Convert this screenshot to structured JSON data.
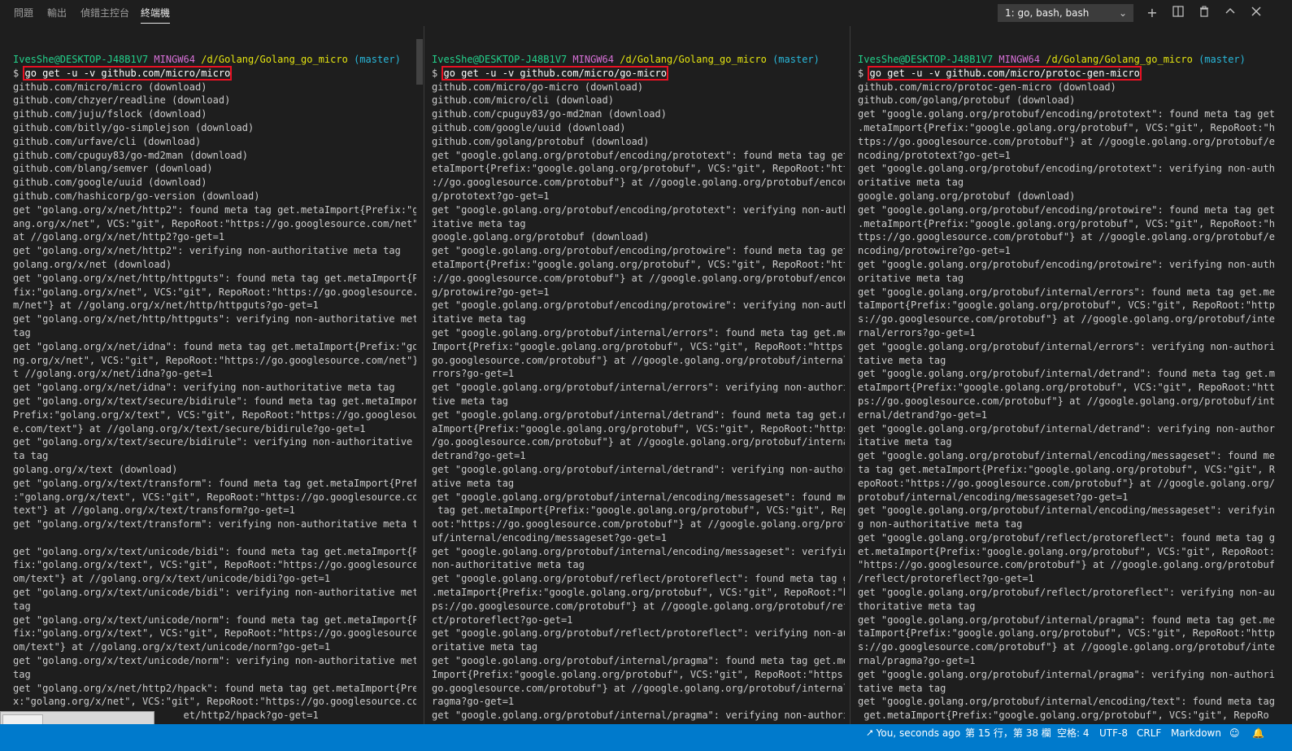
{
  "panel_tabs": [
    "問題",
    "輸出",
    "偵錯主控台",
    "終端機"
  ],
  "terminal_selector": "1: go, bash, bash",
  "toolbar_icons": [
    "plus-icon",
    "split-icon",
    "trash-icon",
    "chevron-up-icon",
    "close-icon"
  ],
  "prompt": {
    "user": "IvesShe@DESKTOP-J48B1V7",
    "system": "MINGW64",
    "path": "/d/Golang/Golang_go_micro",
    "branch": "(master)",
    "symbol": "$"
  },
  "panes": [
    {
      "command": "go get -u -v github.com/micro/micro",
      "output": "github.com/micro/micro (download)\ngithub.com/chzyer/readline (download)\ngithub.com/juju/fslock (download)\ngithub.com/bitly/go-simplejson (download)\ngithub.com/urfave/cli (download)\ngithub.com/cpuguy83/go-md2man (download)\ngithub.com/blang/semver (download)\ngithub.com/google/uuid (download)\ngithub.com/hashicorp/go-version (download)\nget \"golang.org/x/net/http2\": found meta tag get.metaImport{Prefix:\"gol\nang.org/x/net\", VCS:\"git\", RepoRoot:\"https://go.googlesource.com/net\"}\nat //golang.org/x/net/http2?go-get=1\nget \"golang.org/x/net/http2\": verifying non-authoritative meta tag\ngolang.org/x/net (download)\nget \"golang.org/x/net/http/httpguts\": found meta tag get.metaImport{Pre\nfix:\"golang.org/x/net\", VCS:\"git\", RepoRoot:\"https://go.googlesource.co\nm/net\"} at //golang.org/x/net/http/httpguts?go-get=1\nget \"golang.org/x/net/http/httpguts\": verifying non-authoritative meta\ntag\nget \"golang.org/x/net/idna\": found meta tag get.metaImport{Prefix:\"gola\nng.org/x/net\", VCS:\"git\", RepoRoot:\"https://go.googlesource.com/net\"} a\nt //golang.org/x/net/idna?go-get=1\nget \"golang.org/x/net/idna\": verifying non-authoritative meta tag\nget \"golang.org/x/text/secure/bidirule\": found meta tag get.metaImport{\nPrefix:\"golang.org/x/text\", VCS:\"git\", RepoRoot:\"https://go.googlesourc\ne.com/text\"} at //golang.org/x/text/secure/bidirule?go-get=1\nget \"golang.org/x/text/secure/bidirule\": verifying non-authoritative me\nta tag\ngolang.org/x/text (download)\nget \"golang.org/x/text/transform\": found meta tag get.metaImport{Prefix\n:\"golang.org/x/text\", VCS:\"git\", RepoRoot:\"https://go.googlesource.com/\ntext\"} at //golang.org/x/text/transform?go-get=1\nget \"golang.org/x/text/transform\": verifying non-authoritative meta tag\n\nget \"golang.org/x/text/unicode/bidi\": found meta tag get.metaImport{Pre\nfix:\"golang.org/x/text\", VCS:\"git\", RepoRoot:\"https://go.googlesource.c\nom/text\"} at //golang.org/x/text/unicode/bidi?go-get=1\nget \"golang.org/x/text/unicode/bidi\": verifying non-authoritative meta\ntag\nget \"golang.org/x/text/unicode/norm\": found meta tag get.metaImport{Pre\nfix:\"golang.org/x/text\", VCS:\"git\", RepoRoot:\"https://go.googlesource.c\nom/text\"} at //golang.org/x/text/unicode/norm?go-get=1\nget \"golang.org/x/text/unicode/norm\": verifying non-authoritative meta\ntag\nget \"golang.org/x/net/http2/hpack\": found meta tag get.metaImport{Prefi\nx:\"golang.org/x/net\", VCS:\"git\", RepoRoot:\"https://go.googlesource.com/\n                             et/http2/hpack?go-get=1"
    },
    {
      "command": "go get -u -v github.com/micro/go-micro",
      "output": "github.com/micro/go-micro (download)\ngithub.com/micro/cli (download)\ngithub.com/cpuguy83/go-md2man (download)\ngithub.com/google/uuid (download)\ngithub.com/golang/protobuf (download)\nget \"google.golang.org/protobuf/encoding/prototext\": found meta tag get.m\netaImport{Prefix:\"google.golang.org/protobuf\", VCS:\"git\", RepoRoot:\"https\n://go.googlesource.com/protobuf\"} at //google.golang.org/protobuf/encodin\ng/prototext?go-get=1\nget \"google.golang.org/protobuf/encoding/prototext\": verifying non-author\nitative meta tag\ngoogle.golang.org/protobuf (download)\nget \"google.golang.org/protobuf/encoding/protowire\": found meta tag get.m\netaImport{Prefix:\"google.golang.org/protobuf\", VCS:\"git\", RepoRoot:\"https\n://go.googlesource.com/protobuf\"} at //google.golang.org/protobuf/encodin\ng/protowire?go-get=1\nget \"google.golang.org/protobuf/encoding/protowire\": verifying non-author\nitative meta tag\nget \"google.golang.org/protobuf/internal/errors\": found meta tag get.meta\nImport{Prefix:\"google.golang.org/protobuf\", VCS:\"git\", RepoRoot:\"https://\ngo.googlesource.com/protobuf\"} at //google.golang.org/protobuf/internal/e\nrrors?go-get=1\nget \"google.golang.org/protobuf/internal/errors\": verifying non-authorita\ntive meta tag\nget \"google.golang.org/protobuf/internal/detrand\": found meta tag get.met\naImport{Prefix:\"google.golang.org/protobuf\", VCS:\"git\", RepoRoot:\"https:/\n/go.googlesource.com/protobuf\"} at //google.golang.org/protobuf/internal/\ndetrand?go-get=1\nget \"google.golang.org/protobuf/internal/detrand\": verifying non-authorit\native meta tag\nget \"google.golang.org/protobuf/internal/encoding/messageset\": found meta\n tag get.metaImport{Prefix:\"google.golang.org/protobuf\", VCS:\"git\", RepoR\noot:\"https://go.googlesource.com/protobuf\"} at //google.golang.org/protob\nuf/internal/encoding/messageset?go-get=1\nget \"google.golang.org/protobuf/internal/encoding/messageset\": verifying\nnon-authoritative meta tag\nget \"google.golang.org/protobuf/reflect/protoreflect\": found meta tag get\n.metaImport{Prefix:\"google.golang.org/protobuf\", VCS:\"git\", RepoRoot:\"htt\nps://go.googlesource.com/protobuf\"} at //google.golang.org/protobuf/refle\nct/protoreflect?go-get=1\nget \"google.golang.org/protobuf/reflect/protoreflect\": verifying non-auth\noritative meta tag\nget \"google.golang.org/protobuf/internal/pragma\": found meta tag get.meta\nImport{Prefix:\"google.golang.org/protobuf\", VCS:\"git\", RepoRoot:\"https://\ngo.googlesource.com/protobuf\"} at //google.golang.org/protobuf/internal/p\nragma?go-get=1\nget \"google.golang.org/protobuf/internal/pragma\": verifying non-authorita"
    },
    {
      "command": "go get -u -v github.com/micro/protoc-gen-micro",
      "output": "github.com/micro/protoc-gen-micro (download)\ngithub.com/golang/protobuf (download)\nget \"google.golang.org/protobuf/encoding/prototext\": found meta tag get\n.metaImport{Prefix:\"google.golang.org/protobuf\", VCS:\"git\", RepoRoot:\"h\nttps://go.googlesource.com/protobuf\"} at //google.golang.org/protobuf/e\nncoding/prototext?go-get=1\nget \"google.golang.org/protobuf/encoding/prototext\": verifying non-auth\noritative meta tag\ngoogle.golang.org/protobuf (download)\nget \"google.golang.org/protobuf/encoding/protowire\": found meta tag get\n.metaImport{Prefix:\"google.golang.org/protobuf\", VCS:\"git\", RepoRoot:\"h\nttps://go.googlesource.com/protobuf\"} at //google.golang.org/protobuf/e\nncoding/protowire?go-get=1\nget \"google.golang.org/protobuf/encoding/protowire\": verifying non-auth\noritative meta tag\nget \"google.golang.org/protobuf/internal/errors\": found meta tag get.me\ntaImport{Prefix:\"google.golang.org/protobuf\", VCS:\"git\", RepoRoot:\"http\ns://go.googlesource.com/protobuf\"} at //google.golang.org/protobuf/inte\nrnal/errors?go-get=1\nget \"google.golang.org/protobuf/internal/errors\": verifying non-authori\ntative meta tag\nget \"google.golang.org/protobuf/internal/detrand\": found meta tag get.m\netaImport{Prefix:\"google.golang.org/protobuf\", VCS:\"git\", RepoRoot:\"htt\nps://go.googlesource.com/protobuf\"} at //google.golang.org/protobuf/int\nernal/detrand?go-get=1\nget \"google.golang.org/protobuf/internal/detrand\": verifying non-author\nitative meta tag\nget \"google.golang.org/protobuf/internal/encoding/messageset\": found me\nta tag get.metaImport{Prefix:\"google.golang.org/protobuf\", VCS:\"git\", R\nepoRoot:\"https://go.googlesource.com/protobuf\"} at //google.golang.org/\nprotobuf/internal/encoding/messageset?go-get=1\nget \"google.golang.org/protobuf/internal/encoding/messageset\": verifyin\ng non-authoritative meta tag\nget \"google.golang.org/protobuf/reflect/protoreflect\": found meta tag g\net.metaImport{Prefix:\"google.golang.org/protobuf\", VCS:\"git\", RepoRoot:\n\"https://go.googlesource.com/protobuf\"} at //google.golang.org/protobuf\n/reflect/protoreflect?go-get=1\nget \"google.golang.org/protobuf/reflect/protoreflect\": verifying non-au\nthoritative meta tag\nget \"google.golang.org/protobuf/internal/pragma\": found meta tag get.me\ntaImport{Prefix:\"google.golang.org/protobuf\", VCS:\"git\", RepoRoot:\"http\ns://go.googlesource.com/protobuf\"} at //google.golang.org/protobuf/inte\nrnal/pragma?go-get=1\nget \"google.golang.org/protobuf/internal/pragma\": verifying non-authori\ntative meta tag\nget \"google.golang.org/protobuf/internal/encoding/text\": found meta tag\n get.metaImport{Prefix:\"google.golang.org/protobuf\", VCS:\"git\", RepoRo"
    }
  ],
  "status_bar": {
    "git_blame": "You, seconds ago",
    "cursor": "第 15 行，第 38 欄",
    "indent": "空格: 4",
    "encoding": "UTF-8",
    "eol": "CRLF",
    "language": "Markdown",
    "icons": [
      "git-commit-icon",
      "feedback-icon",
      "bell-icon"
    ]
  },
  "colors": {
    "background": "#1e1e1e",
    "status_bar": "#007acc",
    "prompt_user": "#23d18b",
    "prompt_system": "#d670d6",
    "prompt_path": "#e5e510",
    "prompt_branch": "#29b8db",
    "command_highlight": "#e81123"
  }
}
